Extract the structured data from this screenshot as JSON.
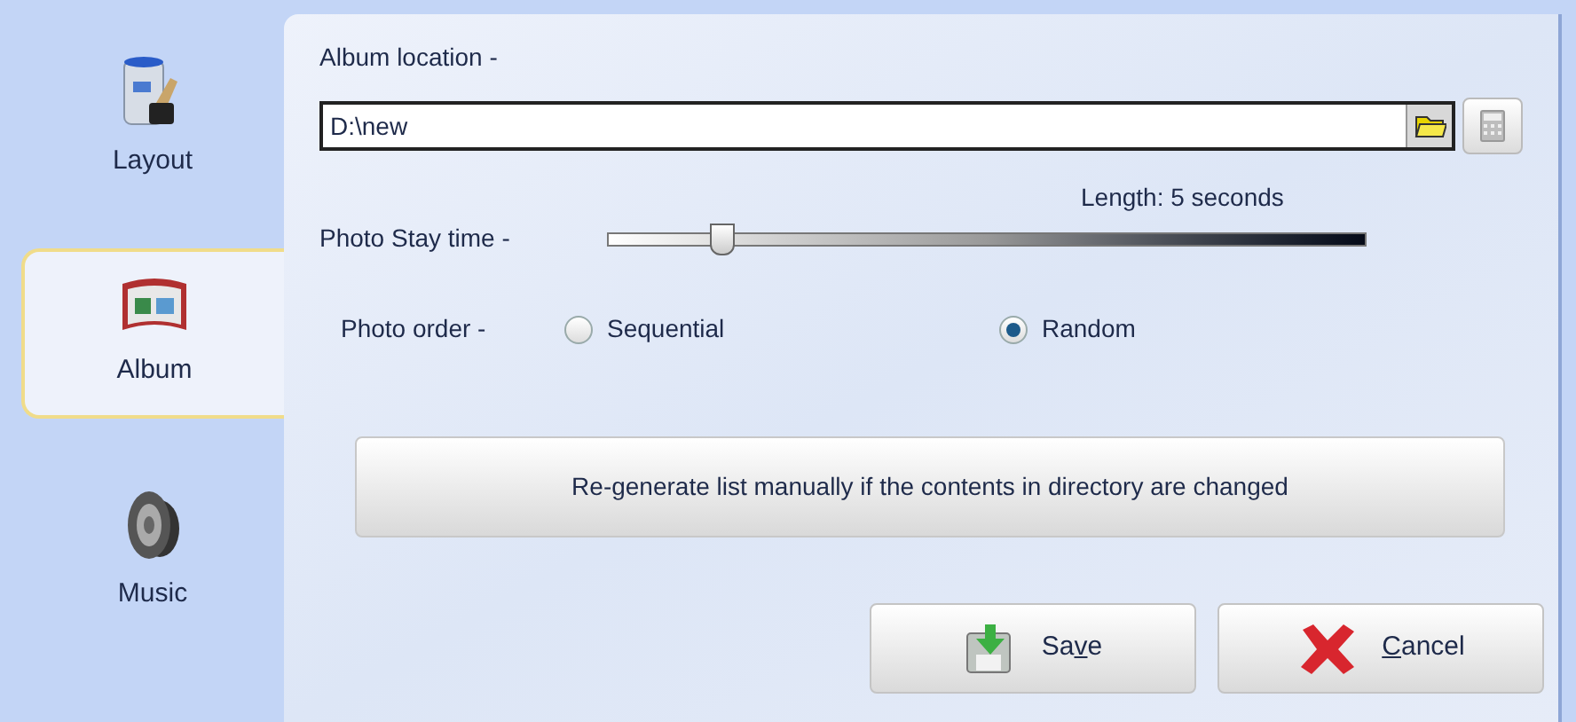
{
  "sidebar": {
    "items": [
      {
        "label": "Layout",
        "kind": "paint",
        "selected": false
      },
      {
        "label": "Album",
        "kind": "album",
        "selected": true
      },
      {
        "label": "Music",
        "kind": "speaker",
        "selected": false
      }
    ]
  },
  "album_location": {
    "label": "Album location -",
    "value": "D:\\new"
  },
  "photo_stay_time": {
    "label": "Photo Stay time -",
    "reading": "Length: 5 seconds",
    "level": 0.15
  },
  "photo_order": {
    "label": "Photo order -",
    "options": [
      {
        "label": "Sequential",
        "selected": false
      },
      {
        "label": "Random",
        "selected": true
      }
    ]
  },
  "regenerate_button": {
    "label": "Re-generate list manually if the contents in directory are changed"
  },
  "buttons": [
    {
      "kind": "save",
      "before": "Sa",
      "mnemonic": "v",
      "after": "e"
    },
    {
      "kind": "cancel",
      "mnemonic": "C",
      "after": "ancel"
    }
  ]
}
